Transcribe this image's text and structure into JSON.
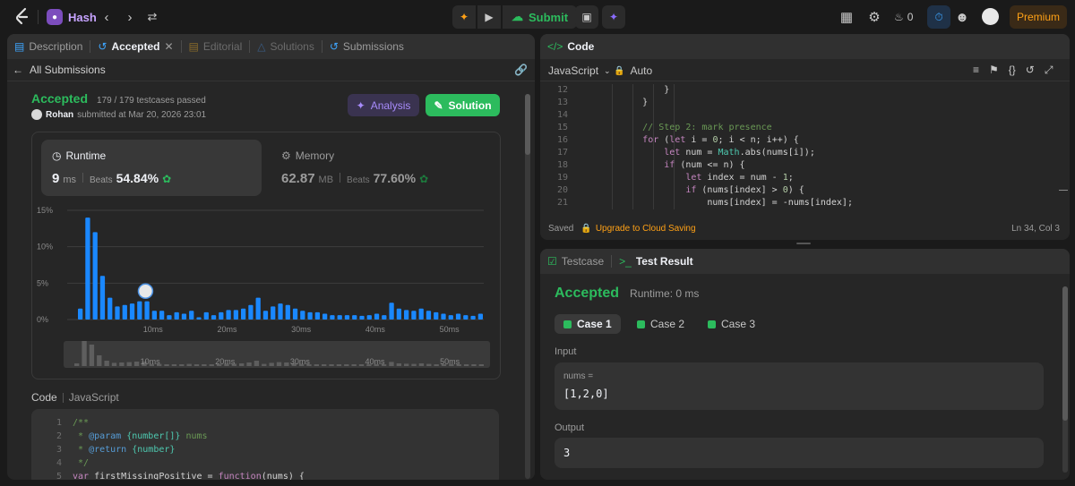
{
  "topbar": {
    "problem_title": "Hash",
    "submit_label": "Submit",
    "streak_count": "0",
    "premium_label": "Premium"
  },
  "left_tabs": [
    {
      "label": "Description"
    },
    {
      "label": "Accepted"
    },
    {
      "label": "Editorial"
    },
    {
      "label": "Solutions"
    },
    {
      "label": "Submissions"
    }
  ],
  "submission": {
    "back_label": "All Submissions",
    "status": "Accepted",
    "testcases": "179 / 179 testcases passed",
    "user": "Rohan",
    "submitted_at": "submitted at Mar 20, 2026 23:01",
    "analysis_label": "Analysis",
    "solution_label": "Solution",
    "runtime_title": "Runtime",
    "runtime_value": "9",
    "runtime_unit": "ms",
    "runtime_beats_label": "Beats",
    "runtime_beats": "54.84%",
    "memory_title": "Memory",
    "memory_value": "62.87",
    "memory_unit": "MB",
    "memory_beats_label": "Beats",
    "memory_beats": "77.60%",
    "code_label": "Code",
    "code_lang": "JavaScript",
    "code_lines": [
      {
        "n": "1",
        "text": "/**"
      },
      {
        "n": "2",
        "text": " * @param {number[]} nums"
      },
      {
        "n": "3",
        "text": " * @return {number}"
      },
      {
        "n": "4",
        "text": " */"
      },
      {
        "n": "5",
        "text": "var firstMissingPositive = function(nums) {"
      }
    ]
  },
  "chart_data": {
    "type": "bar",
    "title": "",
    "xlabel": "",
    "ylabel": "",
    "y_ticks": [
      "15%",
      "10%",
      "5%",
      "0%"
    ],
    "x_ticks": [
      "10ms",
      "20ms",
      "30ms",
      "40ms",
      "50ms"
    ],
    "ylim": [
      0,
      15
    ],
    "xlim": [
      0,
      55
    ],
    "values": [
      1.5,
      14,
      12,
      6,
      3,
      1.8,
      2,
      2.2,
      2.5,
      2.5,
      1.2,
      1.2,
      0.6,
      1,
      0.8,
      1.2,
      0.3,
      1,
      0.6,
      1,
      1.3,
      1.3,
      1.5,
      2,
      3,
      1.2,
      1.8,
      2.2,
      2,
      1.5,
      1.2,
      1,
      1,
      0.8,
      0.6,
      0.6,
      0.6,
      0.6,
      0.5,
      0.6,
      0.8,
      0.6,
      2.3,
      1.5,
      1.3,
      1.2,
      1.5,
      1.2,
      1,
      0.8,
      0.6,
      0.8,
      0.6,
      0.5,
      0.8
    ],
    "highlight_value": "9 ms",
    "grid": true
  },
  "editor": {
    "title": "Code",
    "language": "JavaScript",
    "mode": "Auto",
    "lines": [
      {
        "n": "12",
        "text": "            }"
      },
      {
        "n": "13",
        "text": "        }"
      },
      {
        "n": "14",
        "text": ""
      },
      {
        "n": "15",
        "text": "        // Step 2: mark presence"
      },
      {
        "n": "16",
        "text": "        for (let i = 0; i < n; i++) {"
      },
      {
        "n": "17",
        "text": "            let num = Math.abs(nums[i]);"
      },
      {
        "n": "18",
        "text": "            if (num <= n) {"
      },
      {
        "n": "19",
        "text": "                let index = num - 1;"
      },
      {
        "n": "20",
        "text": "                if (nums[index] > 0) {"
      },
      {
        "n": "21",
        "text": "                    nums[index] = -nums[index];"
      }
    ],
    "saved_label": "Saved",
    "upgrade_label": "Upgrade to Cloud Saving",
    "cursor_pos": "Ln 34, Col 3"
  },
  "result": {
    "testcase_tab": "Testcase",
    "result_tab": "Test Result",
    "status": "Accepted",
    "runtime": "Runtime: 0 ms",
    "cases": [
      "Case 1",
      "Case 2",
      "Case 3"
    ],
    "input_label": "Input",
    "input_name": "nums =",
    "input_value": "[1,2,0]",
    "output_label": "Output",
    "output_value": "3"
  },
  "colors": {
    "accent_green": "#2cbb5d",
    "bar_blue": "#1a88ff",
    "premium_orange": "#ffa116",
    "analysis_purple": "#a78bfa"
  }
}
